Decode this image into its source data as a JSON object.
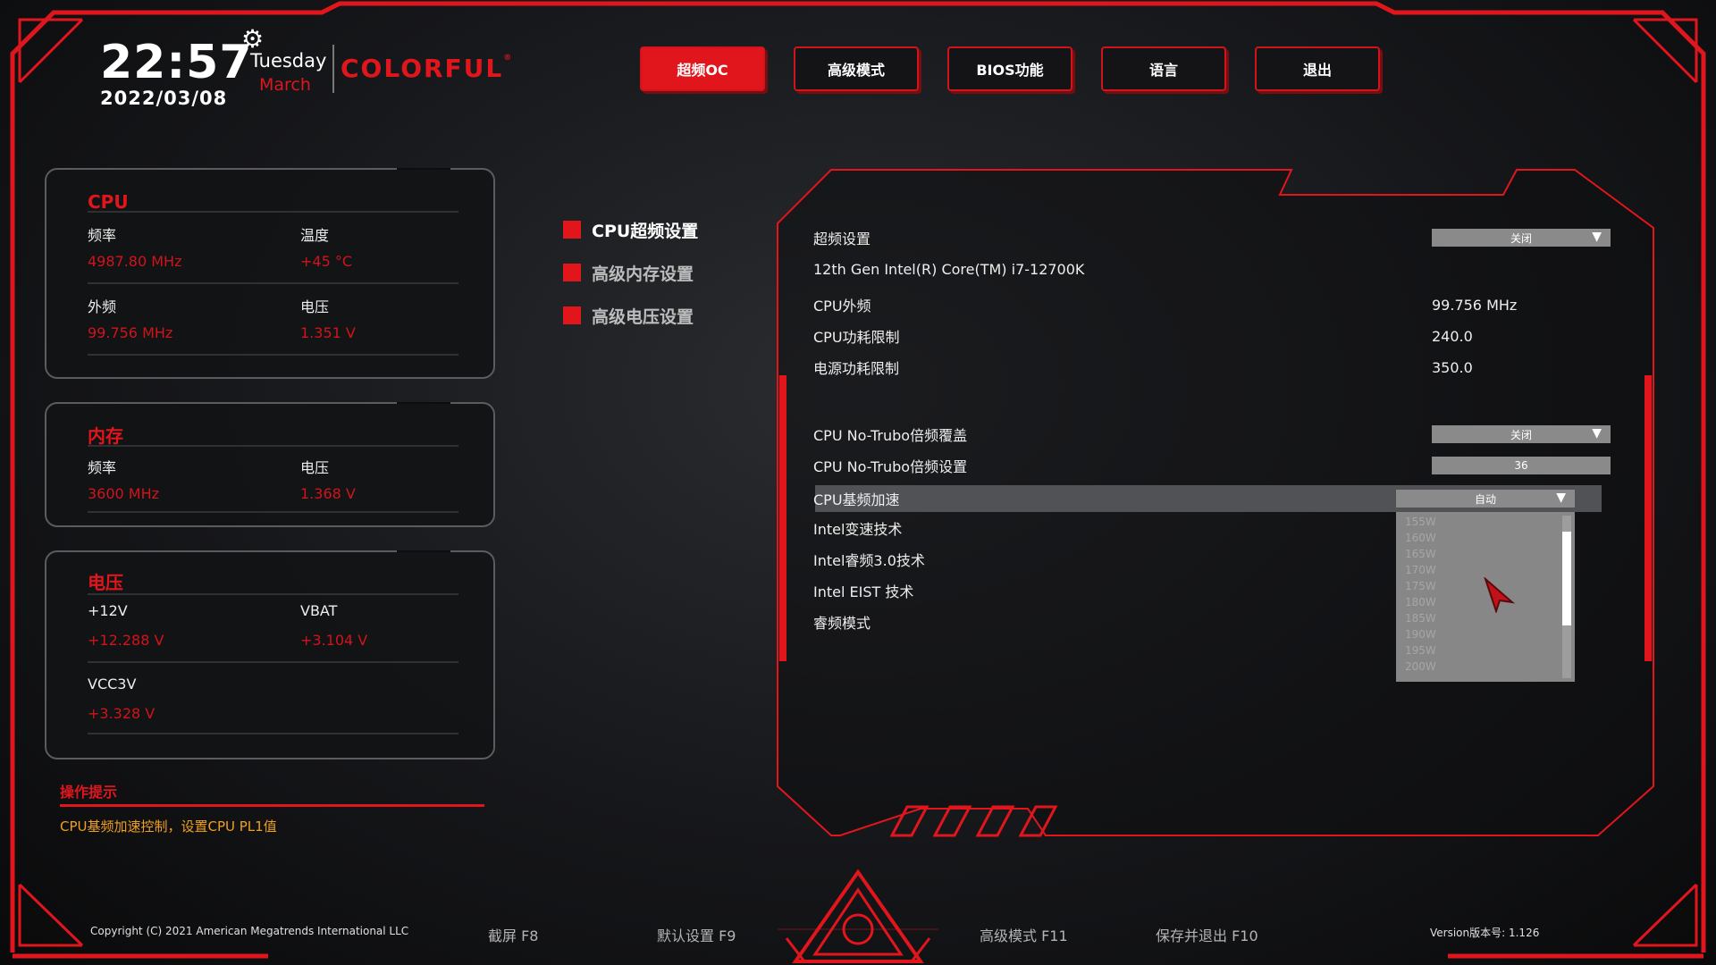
{
  "colors": {
    "accent": "#e0161c",
    "hint": "#f0a020",
    "panel_border": "#5a5c60"
  },
  "header": {
    "time": "22:57",
    "date": "2022/03/08",
    "day": "Tuesday",
    "month": "March",
    "brand": "COLORFUL",
    "brand_mark": "®",
    "gear_icon": "⚙"
  },
  "nav": {
    "tabs": [
      {
        "label": "超频OC",
        "active": true
      },
      {
        "label": "高级模式",
        "active": false
      },
      {
        "label": "BIOS功能",
        "active": false
      },
      {
        "label": "语言",
        "active": false
      },
      {
        "label": "退出",
        "active": false
      }
    ]
  },
  "cpu_panel": {
    "title": "CPU",
    "freq_label": "频率",
    "freq_value": "4987.80 MHz",
    "temp_label": "温度",
    "temp_value": "+45 °C",
    "bclk_label": "外频",
    "bclk_value": "99.756 MHz",
    "volt_label": "电压",
    "volt_value": "1.351 V"
  },
  "mem_panel": {
    "title": "内存",
    "freq_label": "频率",
    "freq_value": "3600 MHz",
    "volt_label": "电压",
    "volt_value": "1.368 V"
  },
  "volt_panel": {
    "title": "电压",
    "v12_label": "+12V",
    "v12_value": "+12.288 V",
    "vbat_label": "VBAT",
    "vbat_value": "+3.104 V",
    "vcc3_label": "VCC3V",
    "vcc3_value": "+3.328 V"
  },
  "hint": {
    "title": "操作提示",
    "text": "CPU基频加速控制，设置CPU PL1值"
  },
  "submenu": {
    "items": [
      {
        "label": "CPU超频设置",
        "active": true
      },
      {
        "label": "高级内存设置",
        "active": false
      },
      {
        "label": "高级电压设置",
        "active": false
      }
    ]
  },
  "settings": {
    "oc_label": "超频设置",
    "oc_value": "关闭",
    "cpu_model": "12th Gen Intel(R) Core(TM) i7-12700K",
    "bclk_label": "CPU外频",
    "bclk_value": "99.756 MHz",
    "power_limit_label": "CPU功耗限制",
    "power_limit_value": "240.0",
    "psu_limit_label": "电源功耗限制",
    "psu_limit_value": "350.0",
    "noturbo_override_label": "CPU No-Trubo倍频覆盖",
    "noturbo_override_value": "关闭",
    "noturbo_ratio_label": "CPU No-Trubo倍频设置",
    "noturbo_ratio_value": "36",
    "base_boost_label": "CPU基频加速",
    "base_boost_value": "自动",
    "speedstep_label": "Intel变速技术",
    "turbo3_label": "Intel睿频3.0技术",
    "eist_label": "Intel EIST 技术",
    "turbo_mode_label": "睿频模式",
    "dropdown_options": [
      "155W",
      "160W",
      "165W",
      "170W",
      "175W",
      "180W",
      "185W",
      "190W",
      "195W",
      "200W"
    ],
    "arrow_icon": "▼"
  },
  "footer": {
    "copyright": "Copyright (C) 2021 American Megatrends International LLC",
    "screenshot": "截屏 F8",
    "defaults": "默认设置 F9",
    "advanced": "高级模式 F11",
    "save_exit": "保存并退出 F10",
    "version": "Version版本号: 1.126"
  }
}
